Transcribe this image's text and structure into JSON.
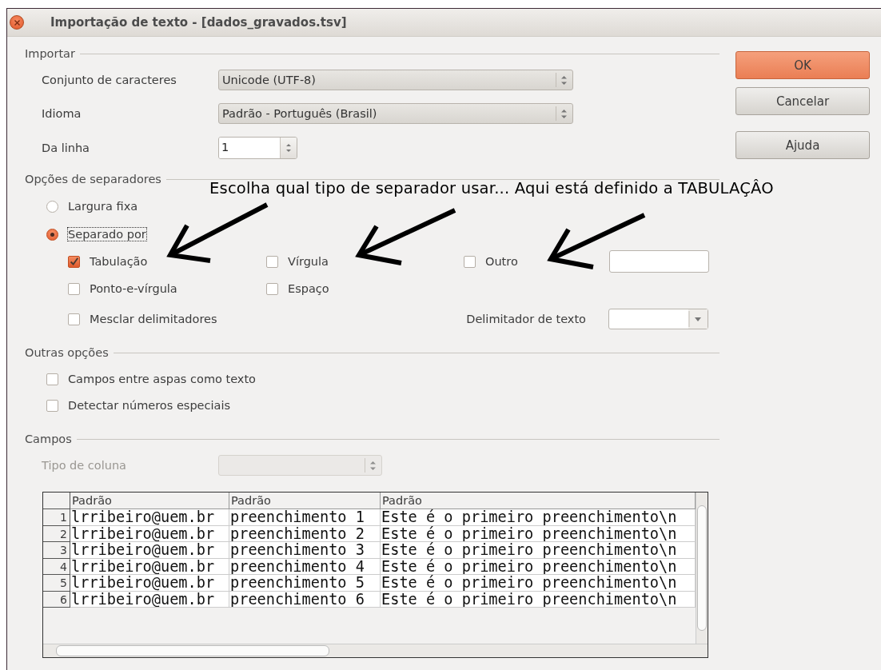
{
  "window": {
    "title": "Importação de texto - [dados_gravados.tsv]"
  },
  "import": {
    "heading": "Importar",
    "fields": [
      {
        "kind": "combo",
        "label": "Conjunto de caracteres",
        "value": "Unicode (UTF-8)"
      },
      {
        "kind": "combo",
        "label": "Idioma",
        "value": "Padrão - Português (Brasil)"
      },
      {
        "kind": "spin",
        "label": "Da linha",
        "value": "1"
      }
    ]
  },
  "separator_options": {
    "heading": "Opções de separadores",
    "modes": [
      {
        "label": "Largura fixa",
        "selected": false,
        "focused": false
      },
      {
        "label": "Separado por",
        "selected": true,
        "focused": true
      }
    ],
    "separators": [
      {
        "kind": "check",
        "label": "Tabulação",
        "checked": true
      },
      {
        "kind": "check",
        "label": "Vírgula",
        "checked": false
      },
      {
        "kind": "check_with_field",
        "label": "Outro",
        "checked": false
      },
      {
        "kind": "check",
        "label": "Ponto-e-vírgula",
        "checked": false
      },
      {
        "kind": "check",
        "label": "Espaço",
        "checked": false
      }
    ],
    "merge_delimiters": {
      "label": "Mesclar delimitadores",
      "checked": false
    },
    "text_delimiter": {
      "label": "Delimitador de texto"
    }
  },
  "other_options": {
    "heading": "Outras opções",
    "options": [
      {
        "label": "Campos entre aspas como texto",
        "checked": false
      },
      {
        "label": "Detectar números especiais",
        "checked": false
      }
    ]
  },
  "fields": {
    "heading": "Campos",
    "column_type": {
      "label": "Tipo de coluna",
      "disabled": true
    },
    "table": {
      "columns": [
        "Padrão",
        "Padrão",
        "Padrão"
      ],
      "rows": [
        {
          "number": "1",
          "cells": [
            "lrribeiro@uem.br",
            "preenchimento 1",
            "Este é o primeiro preenchimento\\n"
          ]
        },
        {
          "number": "2",
          "cells": [
            "lrribeiro@uem.br",
            "preenchimento 2",
            "Este é o primeiro preenchimento\\n"
          ]
        },
        {
          "number": "3",
          "cells": [
            "lrribeiro@uem.br",
            "preenchimento 3",
            "Este é o primeiro preenchimento\\n"
          ]
        },
        {
          "number": "4",
          "cells": [
            "lrribeiro@uem.br",
            "preenchimento 4",
            "Este é o primeiro preenchimento\\n"
          ]
        },
        {
          "number": "5",
          "cells": [
            "lrribeiro@uem.br",
            "preenchimento 5",
            "Este é o primeiro preenchimento\\n"
          ]
        },
        {
          "number": "6",
          "cells": [
            "lrribeiro@uem.br",
            "preenchimento 6",
            "Este é o primeiro preenchimento\\n"
          ]
        }
      ]
    }
  },
  "buttons": [
    {
      "label": "OK",
      "default": true
    },
    {
      "label": "Cancelar",
      "default": false
    },
    {
      "label": "Ajuda",
      "default": false
    }
  ],
  "annotation": {
    "text": "Escolha qual tipo de separador usar... Aqui está definido a TABULAÇÂO"
  }
}
